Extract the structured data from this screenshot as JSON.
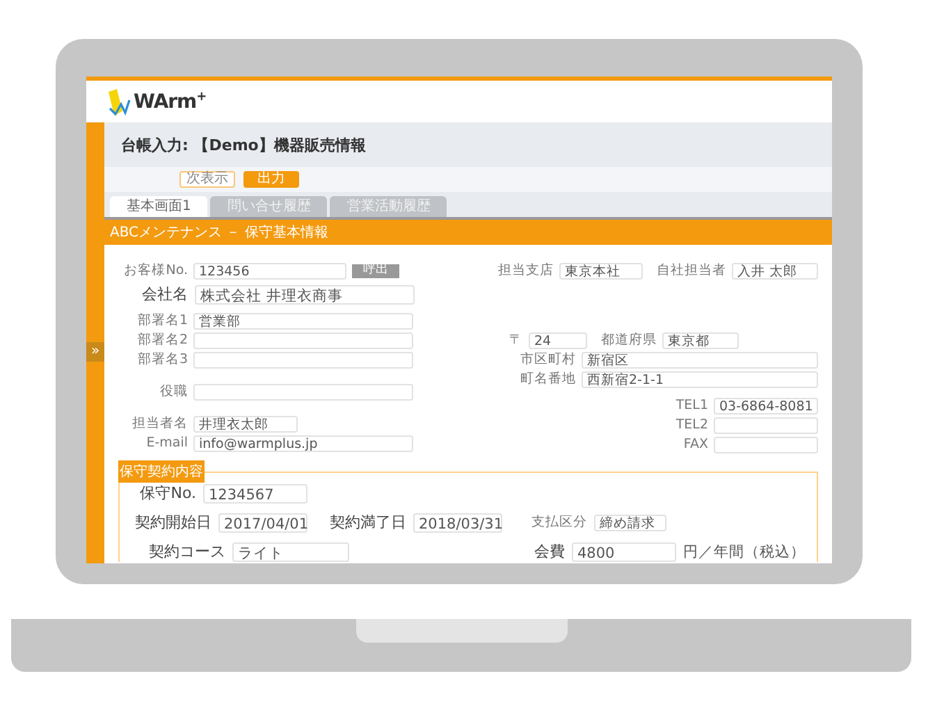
{
  "logo_text": "WArm$^{+}$",
  "title": "台帳入力: 【Demo】機器販売情報",
  "actions": [
    {
      "label": "次表示",
      "kind": "outline"
    },
    {
      "label": "出力",
      "kind": "primary"
    }
  ],
  "tabs": [
    {
      "label": "基本画面1",
      "selected": true
    },
    {
      "label": "問い合せ履歴",
      "selected": false
    },
    {
      "label": "営業活動履歴",
      "selected": false
    }
  ],
  "section_title": "ABCメンテナンス － 保守基本情報",
  "customer": {
    "no_label": "お客様No.",
    "no_value": "123456",
    "lookup_button": "呼出",
    "branch_label": "担当支店",
    "branch_value": "東京本社",
    "staff_label": "自社担当者",
    "staff_value": "入井 太郎",
    "company_label": "会社名",
    "company_value": "株式会社 井理衣商事"
  },
  "left_groups": [
    [
      {
        "label": "部署名1",
        "value": "営業部"
      },
      {
        "label": "部署名2"
      },
      {
        "label": "部署名3"
      }
    ],
    [
      {
        "label": "役職"
      }
    ],
    [
      {
        "label": "担当者名",
        "value": "井理衣太郎"
      },
      {
        "label": "E-mail",
        "value": "info@warmplus.jp"
      }
    ]
  ],
  "address": {
    "postal_label": "〒",
    "postal_value": "24",
    "fields": [
      {
        "label": "都道府県",
        "value": "東京都"
      },
      {
        "label": "市区町村",
        "value": "新宿区"
      },
      {
        "label": "町名番地",
        "value": "西新宿2-1-1"
      }
    ]
  },
  "phones": [
    {
      "label": "TEL1",
      "value": "03-6864-8081"
    },
    {
      "label": "TEL2"
    },
    {
      "label": "FAX"
    }
  ],
  "contract": {
    "legend": "保守契約内容",
    "no_label": "保守No.",
    "no_value": "1234567",
    "start_label": "契約開始日",
    "start_value": "2017/04/01",
    "end_label": "契約満了日",
    "end_value": "2018/03/31",
    "payment_label": "支払区分",
    "payment_value": "締め請求",
    "course_label": "契約コース",
    "course_value": "ライト",
    "fee_label": "会費",
    "fee_value": "4800",
    "fee_unit": "円／年間（税込）"
  },
  "sidebar_toggle": "»"
}
